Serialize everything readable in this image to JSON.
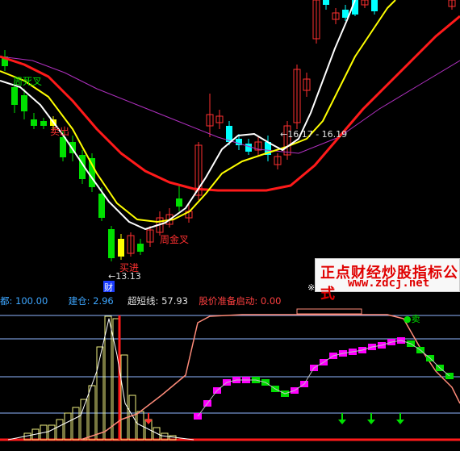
{
  "colors": {
    "background": "#000000",
    "up": "#ff3030",
    "down": "#00ffff",
    "green_down": "#00e000",
    "ma_white": "#ffffff",
    "ma_yellow": "#ffff00",
    "ma_red": "#ff1a1a",
    "ma_purple": "#b030c0",
    "salmon": "#ff8c7a",
    "magenta": "#ff00ff",
    "guide_blue": "#8fb6ff",
    "status_blue": "#3da6ff",
    "status_red": "#ff4040",
    "status_white": "#e0e0e0"
  },
  "main_labels": {
    "death_cross": "周死叉",
    "sell_left": "卖出",
    "gold_cross": "周金叉",
    "buy": "买进",
    "low_price": "←13.13",
    "price_range": "←16.17 - 16.19",
    "cai_tag": "财",
    "x_tag": "※"
  },
  "watermark": {
    "line1": "正点财经炒股指标公式",
    "line2": "www.zdcj.net"
  },
  "status_bar": {
    "item1": "都: 100.00",
    "item2_label": "建仓:",
    "item2_value": "2.96",
    "item3_label": "超短线:",
    "item3_value": "57.93",
    "item4_label": "股价准备启动:",
    "item4_value": "0.00"
  },
  "indicator_labels": {
    "sell_right": "●卖"
  },
  "chart_data": [
    {
      "type": "candlestick",
      "title": "",
      "series": [
        {
          "name": "",
          "kind": "candles",
          "count": 46
        },
        {
          "name": "",
          "kind": "ma_white"
        },
        {
          "name": "",
          "kind": "ma_yellow"
        },
        {
          "name": "",
          "kind": "ma_red"
        },
        {
          "name": "",
          "kind": "ma_purple"
        }
      ],
      "annotations": [
        "周死叉",
        "卖出",
        "周金叉",
        "买进",
        "←13.13",
        "←16.17 - 16.19"
      ]
    },
    {
      "type": "area",
      "title": "",
      "lines": [
        {
          "name": "",
          "kind": "salmon_line"
        },
        {
          "name": "",
          "kind": "magenta_green_step"
        },
        {
          "name": "",
          "kind": "histogram_peaks"
        }
      ],
      "horizontal_guides": 4,
      "down_arrows": 3
    }
  ]
}
